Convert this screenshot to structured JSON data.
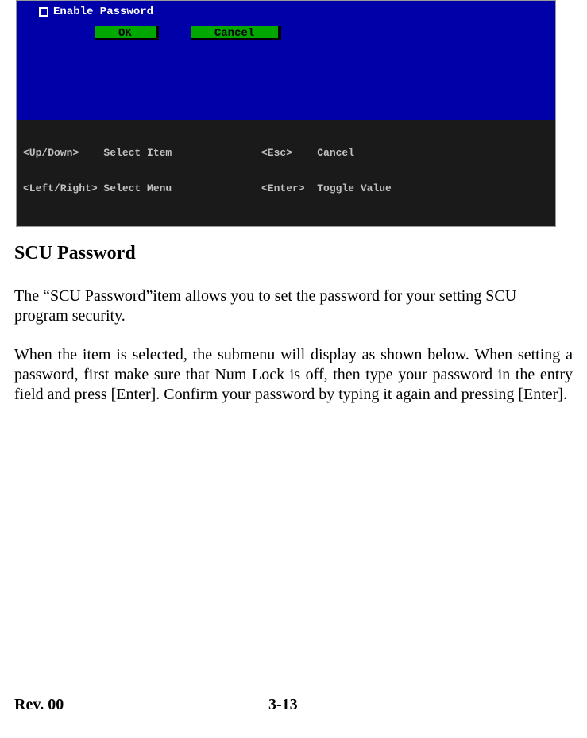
{
  "bios": {
    "checkbox_label": "Enable Password",
    "ok_label": "OK",
    "cancel_label": "Cancel",
    "footer": {
      "left_line1": "<Up/Down>    Select Item",
      "left_line2": "<Left/Right> Select Menu",
      "right_line1": "<Esc>    Cancel",
      "right_line2": "<Enter>  Toggle Value"
    }
  },
  "doc": {
    "heading": "SCU Password",
    "para1": "The “SCU Password”item allows you to set the password for your setting SCU program security.",
    "para2": "When the item is selected, the submenu will display as shown below. When setting a password, first make sure that Num Lock is off, then type your password in the entry field and press [Enter]. Confirm your password by typing it again and pressing [Enter]."
  },
  "footer": {
    "rev": "Rev. 00",
    "page": "3-13"
  }
}
